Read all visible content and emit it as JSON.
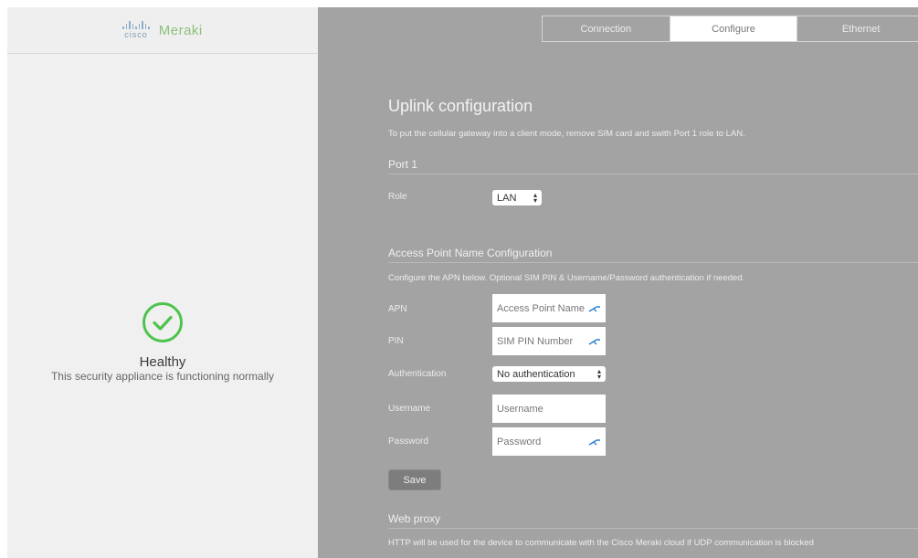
{
  "brand": {
    "cisco": "cisco",
    "meraki": "Meraki"
  },
  "status": {
    "title": "Healthy",
    "description": "This security appliance is functioning normally",
    "icon": "check-circle-icon",
    "color": "#3fbf3f"
  },
  "tabs": [
    {
      "label": "Connection",
      "active": false
    },
    {
      "label": "Configure",
      "active": true
    },
    {
      "label": "Ethernet",
      "active": false
    }
  ],
  "uplink": {
    "title": "Uplink configuration",
    "description": "To put the cellular gateway into a client mode, remove SIM card and swith Port 1 role to LAN."
  },
  "port1": {
    "section_title": "Port 1",
    "role_label": "Role",
    "role_value": "LAN"
  },
  "apn": {
    "section_title": "Access Point Name Configuration",
    "description": "Configure the APN below. Optional SIM PIN & Username/Password authentication if needed.",
    "apn_label": "APN",
    "apn_placeholder": "Access Point Name",
    "pin_label": "PIN",
    "pin_placeholder": "SIM PIN Number",
    "auth_label": "Authentication",
    "auth_value": "No authentication",
    "username_label": "Username",
    "username_placeholder": "Username",
    "password_label": "Password",
    "password_placeholder": "Password",
    "save_label": "Save"
  },
  "proxy": {
    "section_title": "Web proxy",
    "description": "HTTP will be used for the device to communicate with the Cisco Meraki cloud if UDP communication is blocked"
  }
}
